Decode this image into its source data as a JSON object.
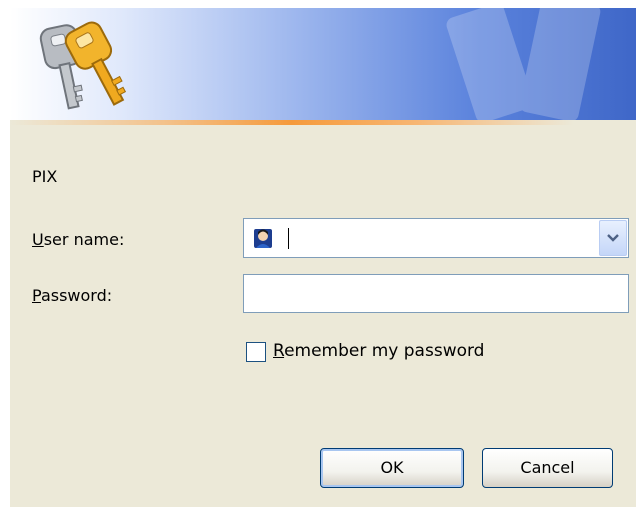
{
  "dialog": {
    "server_name": "PIX",
    "username_label": {
      "accelerator": "U",
      "rest": "ser name:"
    },
    "password_label": {
      "accelerator": "P",
      "rest": "assword:"
    },
    "username_value": "",
    "password_value": "",
    "remember": {
      "accelerator": "R",
      "rest": "emember my password",
      "checked": false
    },
    "buttons": {
      "ok": "OK",
      "cancel": "Cancel"
    },
    "icons": {
      "banner": "keys-icon",
      "user": "user-icon",
      "dropdown": "chevron-down-icon"
    },
    "colors": {
      "dialog_bg": "#ece9d8",
      "banner_blue": "#3f67c8",
      "accent_stripe": "#f59a3c",
      "input_border": "#7f9db9"
    }
  }
}
